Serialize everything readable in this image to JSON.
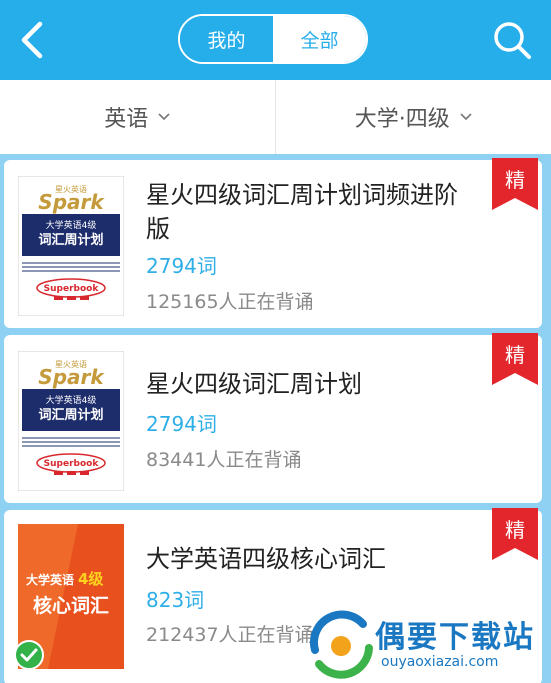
{
  "header": {
    "tabs": [
      {
        "label": "我的",
        "active": false
      },
      {
        "label": "全部",
        "active": true
      }
    ],
    "accent": "#26aeea"
  },
  "filters": {
    "language": "英语",
    "level": "大学·四级"
  },
  "books": [
    {
      "title": "星火四级词汇周计划词频进阶版",
      "word_count": "2794词",
      "learners": "125165人正在背诵",
      "badge": "精",
      "cover": {
        "brand_cn": "星火英语",
        "brand": "Spark",
        "line1": "大学英语4级",
        "line2": "词汇周计划",
        "publisher": "Superbook"
      }
    },
    {
      "title": "星火四级词汇周计划",
      "word_count": "2794词",
      "learners": "83441人正在背诵",
      "badge": "精",
      "cover": {
        "brand_cn": "星火英语",
        "brand": "Spark",
        "line1": "大学英语4级",
        "line2": "词汇周计划",
        "publisher": "Superbook"
      }
    },
    {
      "title": "大学英语四级核心词汇",
      "word_count": "823词",
      "learners": "212437人正在背诵",
      "badge": "精",
      "cover": {
        "line1a": "大学英语",
        "line1b": "4级",
        "line2": "核心词汇"
      }
    }
  ],
  "watermark": {
    "title": "偶要下载站",
    "url": "ouyaoxiazai.com"
  }
}
